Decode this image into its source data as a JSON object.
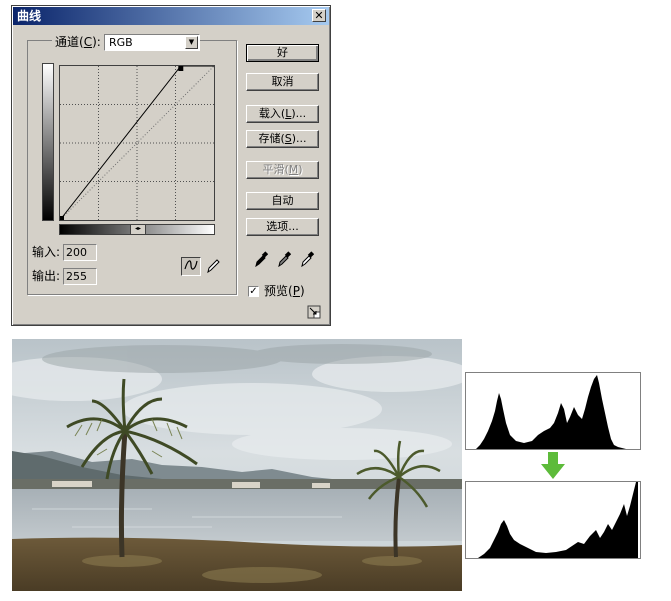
{
  "dialog": {
    "title": "曲线",
    "close_symbol": "✕",
    "channel": {
      "label_prefix": "通道(",
      "label_key": "C",
      "label_suffix": "):",
      "value": "RGB"
    },
    "input": {
      "label": "输入:",
      "value": "200"
    },
    "output": {
      "label": "输出:",
      "value": "255"
    },
    "buttons": {
      "ok": "好",
      "cancel": "取消",
      "load": {
        "prefix": "载入(",
        "key": "L",
        "suffix": ")..."
      },
      "save": {
        "prefix": "存储(",
        "key": "S",
        "suffix": ")..."
      },
      "smooth": {
        "prefix": "平滑(",
        "key": "M",
        "suffix": ")"
      },
      "auto": "自动",
      "options": "选项..."
    },
    "preview": {
      "checked": true,
      "mark": "✓",
      "prefix": "预览(",
      "key": "P",
      "suffix": ")"
    },
    "curve": {
      "input_points": [
        0,
        200
      ],
      "output_points": [
        0,
        255
      ],
      "range": [
        0,
        255
      ]
    },
    "icons": {
      "curve_tool": "curve-tool-icon",
      "pencil_tool": "pencil-icon",
      "droppers": [
        "black-eyedropper-icon",
        "gray-eyedropper-icon",
        "white-eyedropper-icon"
      ],
      "expand": "expand-view-icon",
      "gradient_toggle": "◂▸"
    }
  },
  "photo": {
    "subject": "palm-trees-by-river"
  },
  "histograms": {
    "before_label": "histogram-before",
    "after_label": "histogram-after",
    "arrow_color": "#5dbb3a"
  },
  "colors": {
    "dialog_face": "#d4d0c8",
    "titlebar": "#0a246a",
    "arrow": "#5dbb3a"
  }
}
